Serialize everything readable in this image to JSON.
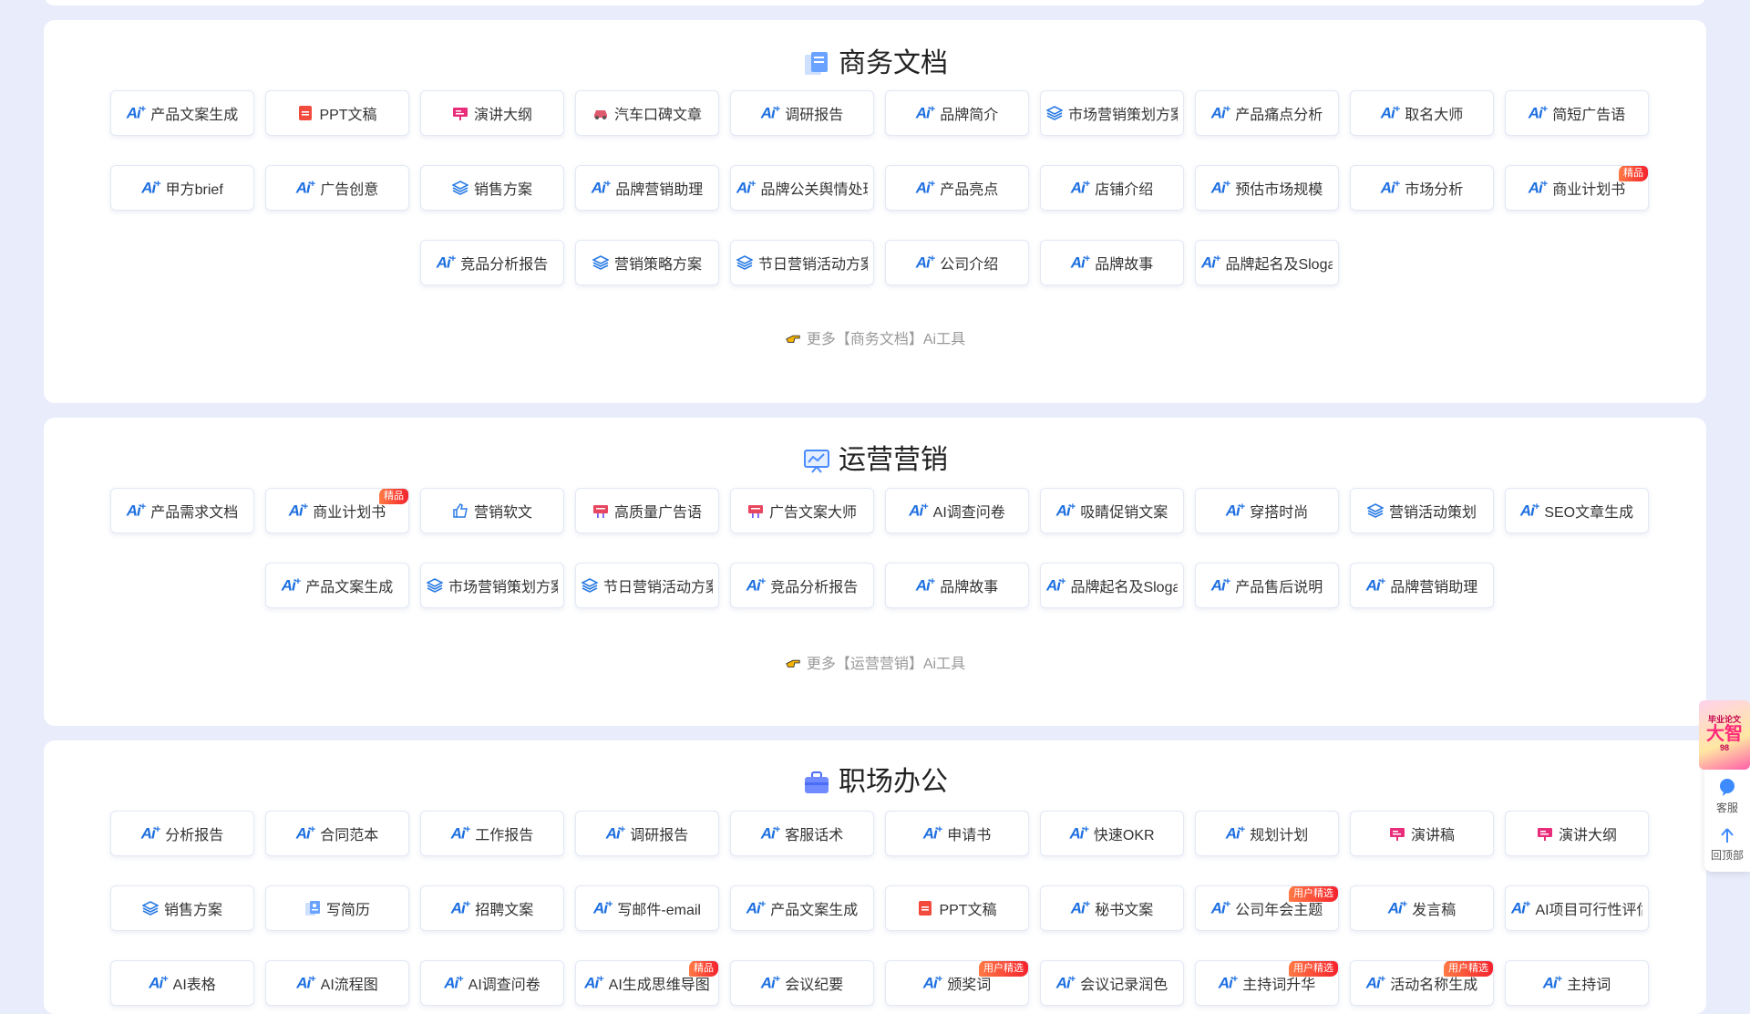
{
  "sections": [
    {
      "title": "商务文档",
      "more": "更多【商务文档】Ai工具",
      "rows": [
        [
          {
            "label": "产品文案生成",
            "icon": "ai-icon"
          },
          {
            "label": "PPT文稿",
            "icon": "ppt-icon"
          },
          {
            "label": "演讲大纲",
            "icon": "presentation-icon"
          },
          {
            "label": "汽车口碑文章",
            "icon": "car-icon"
          },
          {
            "label": "调研报告",
            "icon": "ai-icon"
          },
          {
            "label": "品牌简介",
            "icon": "ai-icon"
          },
          {
            "label": "市场营销策划方案",
            "icon": "layers-icon"
          },
          {
            "label": "产品痛点分析",
            "icon": "ai-icon"
          },
          {
            "label": "取名大师",
            "icon": "ai-icon"
          },
          {
            "label": "简短广告语",
            "icon": "ai-icon"
          }
        ],
        [
          {
            "label": "甲方brief",
            "icon": "ai-icon"
          },
          {
            "label": "广告创意",
            "icon": "ai-icon"
          },
          {
            "label": "销售方案",
            "icon": "layers-icon"
          },
          {
            "label": "品牌营销助理",
            "icon": "ai-icon"
          },
          {
            "label": "品牌公关舆情处理",
            "icon": "ai-icon"
          },
          {
            "label": "产品亮点",
            "icon": "ai-icon"
          },
          {
            "label": "店铺介绍",
            "icon": "ai-icon"
          },
          {
            "label": "预估市场规模",
            "icon": "ai-icon"
          },
          {
            "label": "市场分析",
            "icon": "ai-icon"
          },
          {
            "label": "商业计划书",
            "icon": "ai-icon",
            "badge": "精品"
          }
        ],
        [
          {
            "label": "竞品分析报告",
            "icon": "ai-icon"
          },
          {
            "label": "营销策略方案",
            "icon": "layers-icon"
          },
          {
            "label": "节日营销活动方案",
            "icon": "layers-icon"
          },
          {
            "label": "公司介绍",
            "icon": "ai-icon"
          },
          {
            "label": "品牌故事",
            "icon": "ai-icon"
          },
          {
            "label": "品牌起名及Slogan",
            "icon": "ai-icon"
          }
        ]
      ]
    },
    {
      "title": "运营营销",
      "more": "更多【运营营销】Ai工具",
      "rows": [
        [
          {
            "label": "产品需求文档",
            "icon": "ai-icon"
          },
          {
            "label": "商业计划书",
            "icon": "ai-icon",
            "badge": "精品"
          },
          {
            "label": "营销软文",
            "icon": "thumbs-up-icon"
          },
          {
            "label": "高质量广告语",
            "icon": "billboard-icon"
          },
          {
            "label": "广告文案大师",
            "icon": "billboard-icon"
          },
          {
            "label": "AI调查问卷",
            "icon": "ai-icon"
          },
          {
            "label": "吸睛促销文案",
            "icon": "ai-icon"
          },
          {
            "label": "穿搭时尚",
            "icon": "ai-icon"
          },
          {
            "label": "营销活动策划",
            "icon": "layers-icon"
          },
          {
            "label": "SEO文章生成",
            "icon": "ai-icon"
          }
        ],
        [
          {
            "label": "产品文案生成",
            "icon": "ai-icon"
          },
          {
            "label": "市场营销策划方案",
            "icon": "layers-icon"
          },
          {
            "label": "节日营销活动方案",
            "icon": "layers-icon"
          },
          {
            "label": "竞品分析报告",
            "icon": "ai-icon"
          },
          {
            "label": "品牌故事",
            "icon": "ai-icon"
          },
          {
            "label": "品牌起名及Slogan",
            "icon": "ai-icon"
          },
          {
            "label": "产品售后说明",
            "icon": "ai-icon"
          },
          {
            "label": "品牌营销助理",
            "icon": "ai-icon"
          }
        ]
      ]
    },
    {
      "title": "职场办公",
      "rows": [
        [
          {
            "label": "分析报告",
            "icon": "ai-icon"
          },
          {
            "label": "合同范本",
            "icon": "ai-icon"
          },
          {
            "label": "工作报告",
            "icon": "ai-icon"
          },
          {
            "label": "调研报告",
            "icon": "ai-icon"
          },
          {
            "label": "客服话术",
            "icon": "ai-icon"
          },
          {
            "label": "申请书",
            "icon": "ai-icon"
          },
          {
            "label": "快速OKR",
            "icon": "ai-icon"
          },
          {
            "label": "规划计划",
            "icon": "ai-icon"
          },
          {
            "label": "演讲稿",
            "icon": "presentation-icon"
          },
          {
            "label": "演讲大纲",
            "icon": "presentation-icon"
          }
        ],
        [
          {
            "label": "销售方案",
            "icon": "layers-icon"
          },
          {
            "label": "写简历",
            "icon": "resume-icon"
          },
          {
            "label": "招聘文案",
            "icon": "ai-icon"
          },
          {
            "label": "写邮件-email",
            "icon": "ai-icon"
          },
          {
            "label": "产品文案生成",
            "icon": "ai-icon"
          },
          {
            "label": "PPT文稿",
            "icon": "ppt-icon"
          },
          {
            "label": "秘书文案",
            "icon": "ai-icon"
          },
          {
            "label": "公司年会主题",
            "icon": "ai-icon",
            "badge": "用户精选"
          },
          {
            "label": "发言稿",
            "icon": "ai-icon"
          },
          {
            "label": "AI项目可行性评估",
            "icon": "ai-icon"
          }
        ],
        [
          {
            "label": "AI表格",
            "icon": "ai-icon"
          },
          {
            "label": "AI流程图",
            "icon": "ai-icon"
          },
          {
            "label": "AI调查问卷",
            "icon": "ai-icon"
          },
          {
            "label": "AI生成思维导图",
            "icon": "ai-icon",
            "badge": "精品"
          },
          {
            "label": "会议纪要",
            "icon": "ai-icon"
          },
          {
            "label": "颁奖词",
            "icon": "ai-icon",
            "badge": "用户精选"
          },
          {
            "label": "会议记录润色",
            "icon": "ai-icon"
          },
          {
            "label": "主持词升华",
            "icon": "ai-icon",
            "badge": "用户精选"
          },
          {
            "label": "活动名称生成",
            "icon": "ai-icon",
            "badge": "用户精选"
          },
          {
            "label": "主持词",
            "icon": "ai-icon"
          }
        ]
      ]
    }
  ],
  "sidebar": {
    "promo_top": "毕业论文",
    "promo_big": "大智",
    "promo_num": "98",
    "service_label": "客服",
    "top_label": "回顶部"
  },
  "colors": {
    "accent": "#1d6fe0",
    "badge": "#f5222d",
    "page_bg": "#e8ecfb"
  }
}
